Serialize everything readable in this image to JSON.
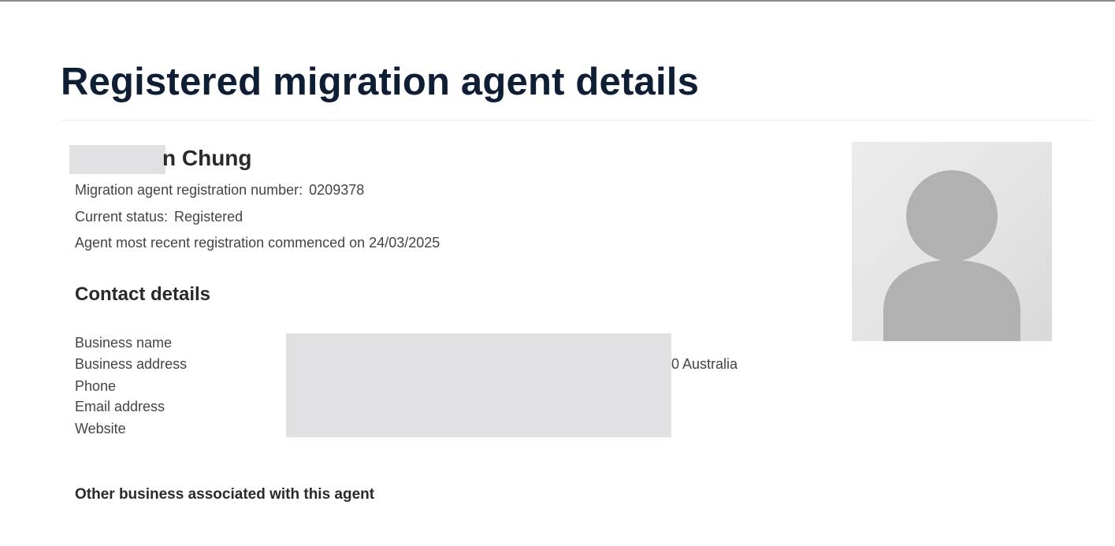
{
  "page": {
    "title": "Registered migration agent details"
  },
  "agent": {
    "name_visible": "n Chung",
    "registration_label": "Migration agent registration number:",
    "registration_number": "0209378",
    "status_label": "Current status:",
    "status_value": "Registered",
    "commenced_text": "Agent most recent registration commenced on 24/03/2025",
    "photo_icon": "default-avatar-icon"
  },
  "contact": {
    "heading": "Contact details",
    "labels": {
      "business_name": "Business name",
      "business_address": "Business address",
      "phone": "Phone",
      "email": "Email address",
      "website": "Website"
    },
    "business_address_visible_suffix": "0 Australia"
  },
  "other_business": {
    "heading": "Other business associated with this agent"
  },
  "colors": {
    "title": "#0e1f35",
    "text": "#444444",
    "redaction": "#e1e1e3",
    "avatar_figure": "#b1b1b1"
  }
}
